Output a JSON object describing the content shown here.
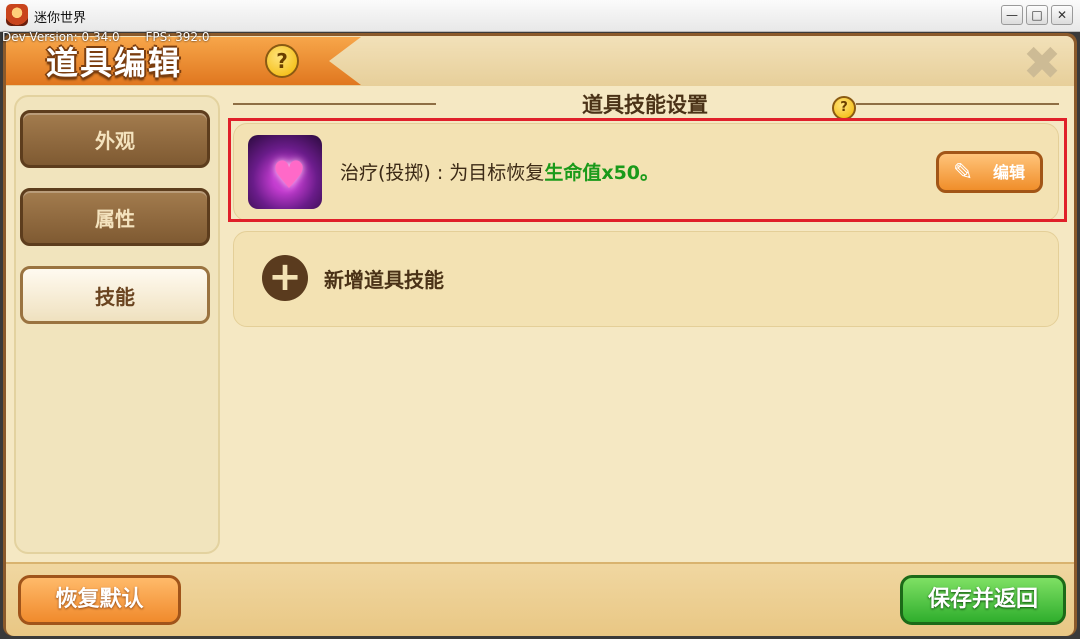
{
  "window": {
    "title": "迷你世界",
    "dev_version": "Dev Version: 0.34.0",
    "fps": "FPS: 392.0",
    "min_icon": "minimize-icon",
    "max_icon": "maximize-icon",
    "close_icon": "close-icon"
  },
  "header": {
    "title": "道具编辑",
    "help_glyph": "?",
    "close_glyph": "✖"
  },
  "sidebar": {
    "items": [
      {
        "label": "外观",
        "selected": false
      },
      {
        "label": "属性",
        "selected": false
      },
      {
        "label": "技能",
        "selected": true
      }
    ]
  },
  "main": {
    "section_title": "道具技能设置",
    "help_glyph": "?",
    "skill": {
      "icon": "heart-heal-icon",
      "desc_prefix": "治疗(投掷) : 为目标恢复",
      "desc_highlight": "生命值",
      "desc_suffix": "x50。",
      "edit_label": "编辑"
    },
    "add_skill": {
      "icon": "plus-icon",
      "label": "新增道具技能"
    }
  },
  "footer": {
    "reset_label": "恢复默认",
    "save_label": "保存并返回"
  },
  "colors": {
    "accent_orange": "#f08a2c",
    "save_green": "#2fae2d",
    "highlight_green": "#1a9a1a",
    "selection_red": "#e0202a"
  }
}
